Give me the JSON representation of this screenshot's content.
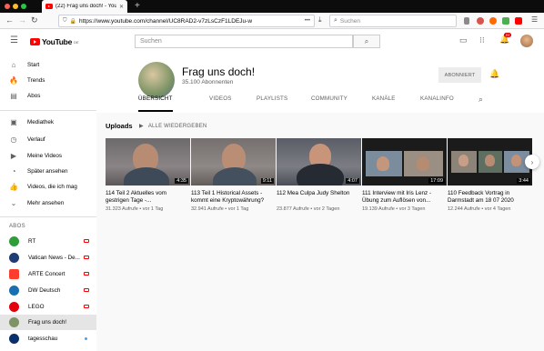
{
  "browser": {
    "tab_title": "(22) Frag uns doch! - YouTube",
    "url": "https://www.youtube.com/channel/UC8RAD2-v7zLsCzF1LDEJu-w",
    "search_placeholder": "Suchen"
  },
  "youtube": {
    "logo_text": "YouTube",
    "logo_region": "DE",
    "search_placeholder": "Suchen",
    "notification_count": "22"
  },
  "sidebar": {
    "items": [
      {
        "label": "Start",
        "icon": "home-icon"
      },
      {
        "label": "Trends",
        "icon": "trending-icon"
      },
      {
        "label": "Abos",
        "icon": "subscriptions-icon"
      },
      {
        "label": "Mediathek",
        "icon": "library-icon"
      },
      {
        "label": "Verlauf",
        "icon": "history-icon"
      },
      {
        "label": "Meine Videos",
        "icon": "my-videos-icon"
      },
      {
        "label": "Später ansehen",
        "icon": "watch-later-icon"
      },
      {
        "label": "Videos, die ich mag",
        "icon": "like-icon"
      },
      {
        "label": "Mehr ansehen",
        "icon": "chevron-down-icon"
      }
    ],
    "abos_heading": "ABOS",
    "subscriptions": [
      {
        "label": "RT",
        "color": "#2f9e3a",
        "live": true
      },
      {
        "label": "Vatican News - De...",
        "color": "#1f3c74",
        "live": true
      },
      {
        "label": "ARTE Concert",
        "color": "#ff3d2e",
        "live": true
      },
      {
        "label": "DW Deutsch",
        "color": "#1a6fb3",
        "live": true
      },
      {
        "label": "LEGO",
        "color": "#e3000b",
        "live": true
      },
      {
        "label": "Frag uns doch!",
        "color": "#7e9466",
        "live": false
      },
      {
        "label": "tagesschau",
        "color": "#0b2f6b",
        "live": false
      }
    ]
  },
  "channel": {
    "name": "Frag uns doch!",
    "subscribers": "35.100 Abonnenten",
    "subscribe_label": "ABONNIERT",
    "tabs": [
      "ÜBERSICHT",
      "VIDEOS",
      "PLAYLISTS",
      "COMMUNITY",
      "KANÄLE",
      "KANALINFO"
    ],
    "active_tab": "ÜBERSICHT"
  },
  "uploads": {
    "heading": "Uploads",
    "play_all": "ALLE WIEDERGEBEN",
    "videos": [
      {
        "title": "114 Teil 2 Aktuelles vom gestrigen Tage -...",
        "meta": "31.323 Aufrufe • vor 1 Tag",
        "duration": "4:35"
      },
      {
        "title": "113 Teil 1 Historical Assets - kommt eine Kryptowährung?",
        "meta": "32.941 Aufrufe • vor 1 Tag",
        "duration": "9:11"
      },
      {
        "title": "112 Mea Culpa Judy Shelton",
        "meta": "23.877 Aufrufe • vor 2 Tagen",
        "duration": "4:07"
      },
      {
        "title": "111 Interview mit Iris Lenz - Übung zum Auflösen von...",
        "meta": "19.139 Aufrufe • vor 3 Tagen",
        "duration": "17:09"
      },
      {
        "title": "110 Feedback Vortrag in Darmstadt am 18 07 2020",
        "meta": "12.244 Aufrufe • vor 4 Tagen",
        "duration": "3:44"
      }
    ]
  }
}
